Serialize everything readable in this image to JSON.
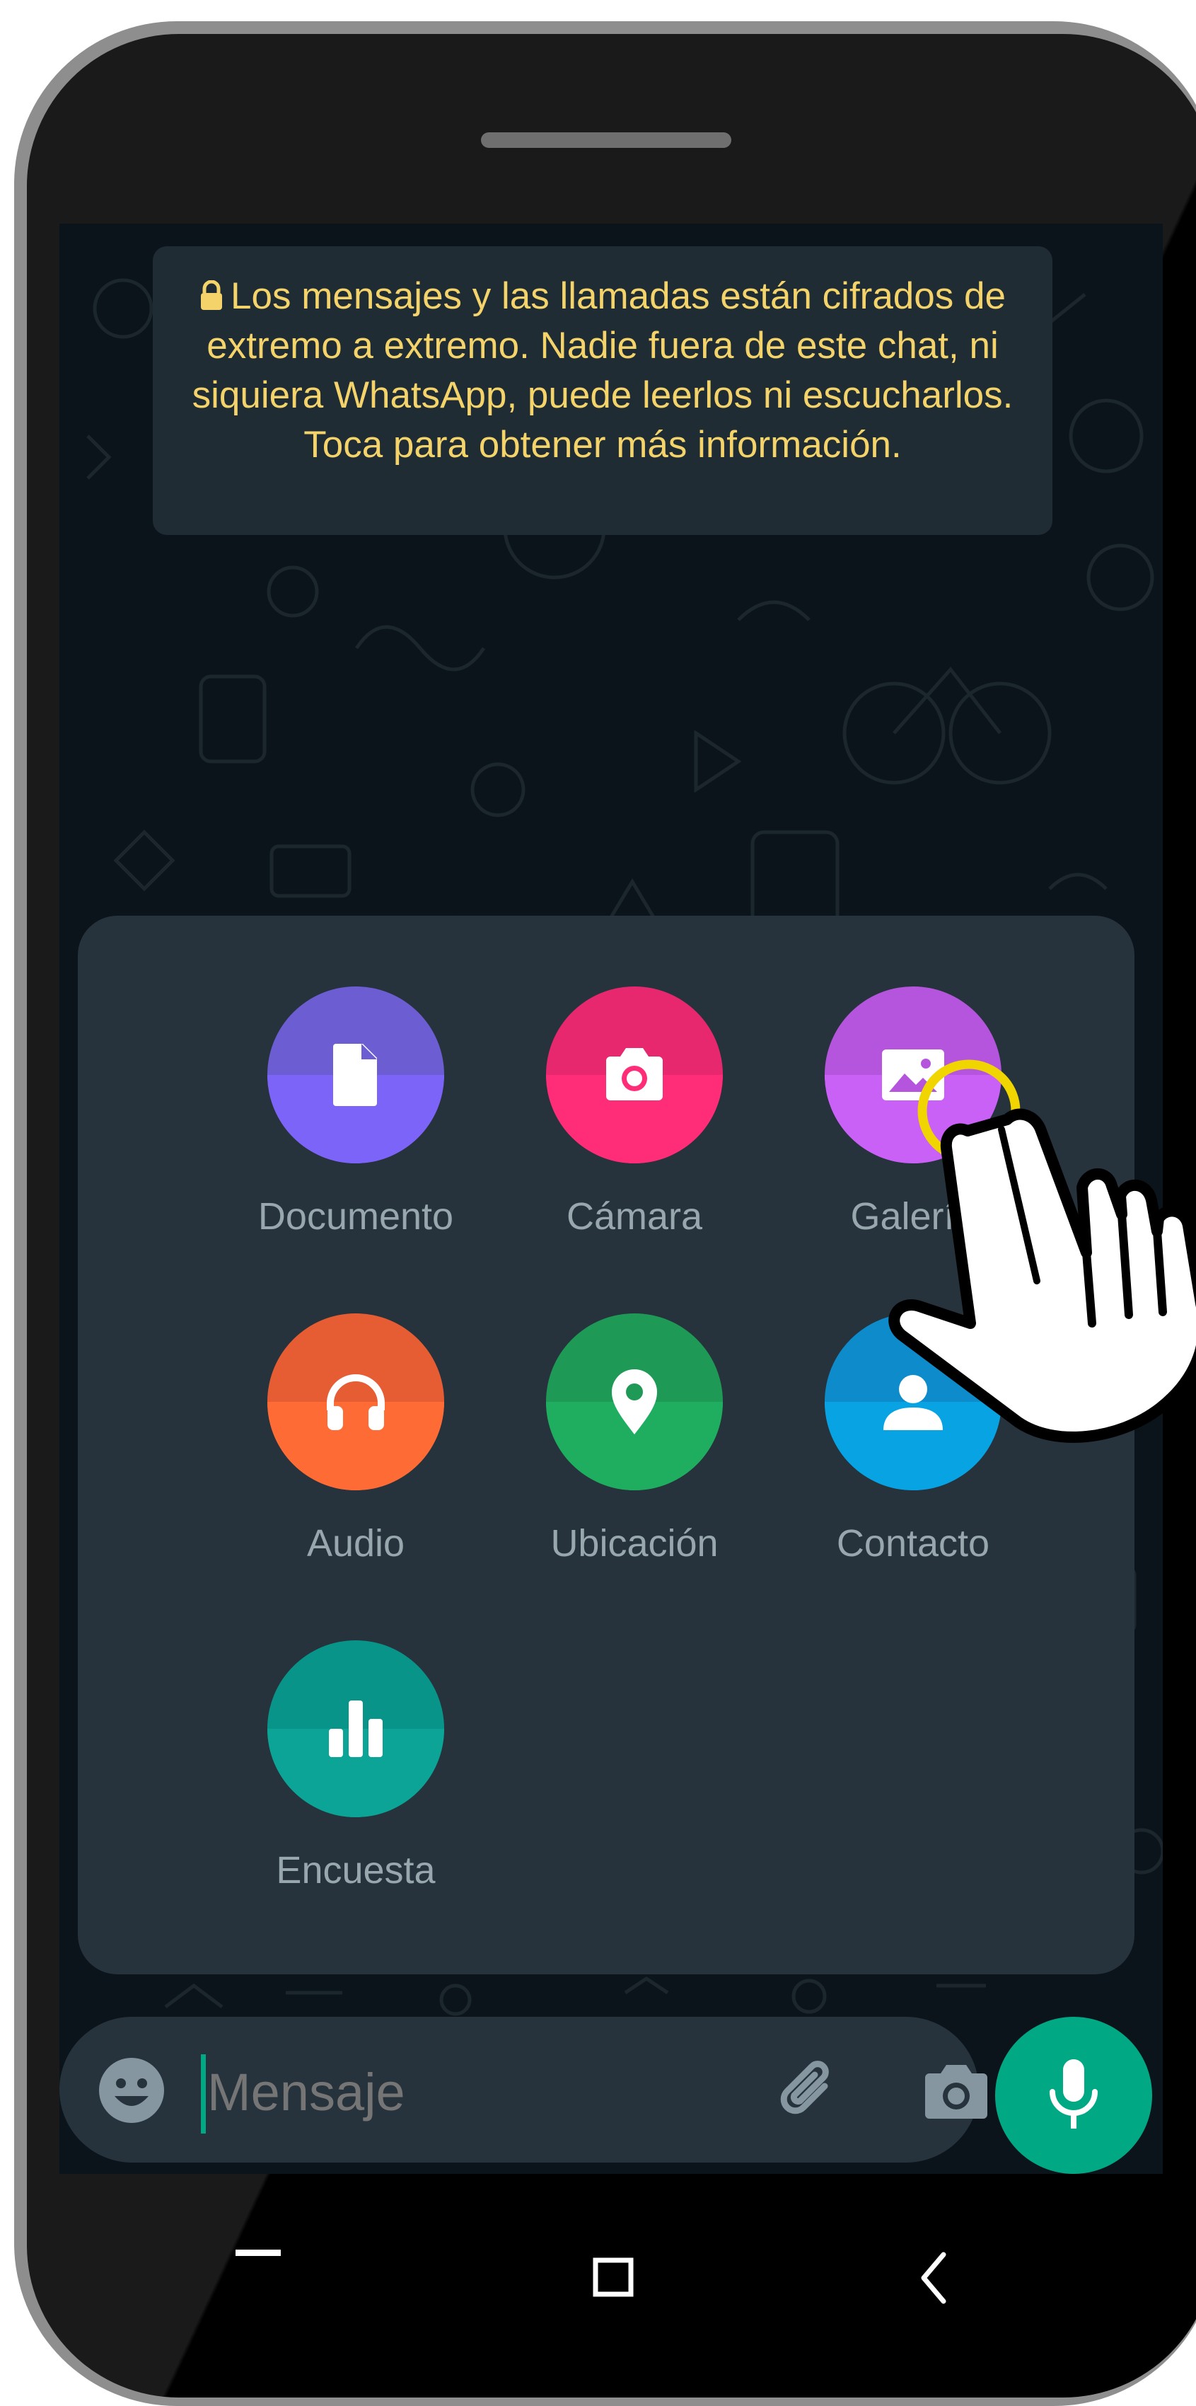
{
  "encryption_notice": "Los mensajes y las llamadas están cifrados de extremo a extremo. Nadie fuera de este chat, ni siquiera WhatsApp, puede leerlos ni escucharlos. Toca para obtener más información.",
  "attach_menu": {
    "options": [
      {
        "label": "Documento",
        "icon": "document-icon",
        "color_top": "#6c5ed2",
        "color_bottom": "#7c64f9"
      },
      {
        "label": "Cámara",
        "icon": "camera-icon",
        "color_top": "#e8286e",
        "color_bottom": "#ff2d77"
      },
      {
        "label": "Galería",
        "icon": "gallery-icon",
        "color_top": "#b555de",
        "color_bottom": "#c961f7"
      },
      {
        "label": "Audio",
        "icon": "headphones-icon",
        "color_top": "#e65d34",
        "color_bottom": "#ff6b35"
      },
      {
        "label": "Ubicación",
        "icon": "location-pin-icon",
        "color_top": "#1f9a56",
        "color_bottom": "#1fae5f"
      },
      {
        "label": "Contacto",
        "icon": "person-icon",
        "color_top": "#0e8bcb",
        "color_bottom": "#08a3e3"
      },
      {
        "label": "Encuesta",
        "icon": "poll-icon",
        "color_top": "#09948a",
        "color_bottom": "#0ba496"
      }
    ]
  },
  "composer": {
    "placeholder": "Mensaje",
    "emoji_icon": "emoji-icon",
    "attach_icon": "paperclip-icon",
    "camera_icon": "camera-icon",
    "send_icon": "microphone-icon"
  },
  "colors": {
    "accent": "#00a884",
    "notice_text": "#f4d36b",
    "panel_bg": "#26333c",
    "chat_bg": "#0b141a"
  }
}
